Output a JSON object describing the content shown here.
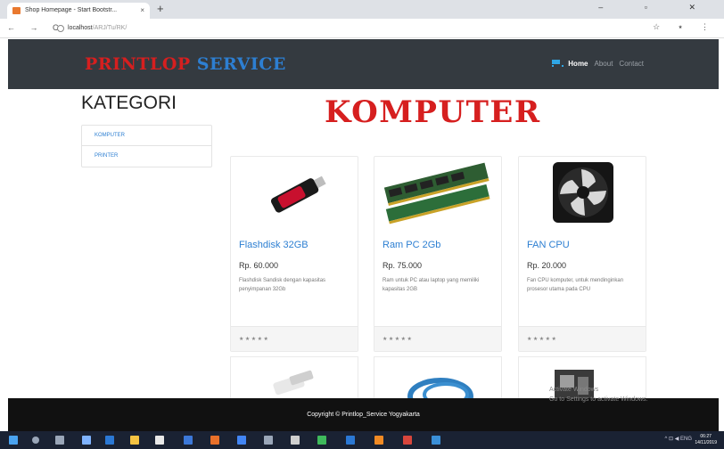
{
  "browser": {
    "tab_title": "Shop Homepage - Start Bootstr...",
    "tab_close": "×",
    "new_tab": "+",
    "window_controls": "– ▫ ✕",
    "nav_buttons": "← → C",
    "url_host": "localhost",
    "url_path": "/ARJ/Tu/RK/",
    "addr_right_icons": "☆ ⭑ ⋮"
  },
  "site": {
    "brand_part1": "PRINTLOP",
    "brand_part2": "SERVICE",
    "nav": [
      {
        "label": "Home"
      },
      {
        "label": "About"
      },
      {
        "label": "Contact"
      }
    ],
    "accent_red": "#d61f1f",
    "accent_blue": "#2d7fd2"
  },
  "sidebar": {
    "title": "KATEGORI",
    "items": [
      {
        "label": "KOMPUTER"
      },
      {
        "label": "PRINTER"
      }
    ]
  },
  "main": {
    "heading": "KOMPUTER",
    "products": [
      {
        "name": "Flashdisk 32GB",
        "price": "Rp. 60.000",
        "description": "Flashdisk Sandisk dengan kapasitas penyimpanan 32Gb",
        "rating": "★★★★★",
        "icon": "flashdisk-image"
      },
      {
        "name": "Ram PC 2Gb",
        "price": "Rp. 75.000",
        "description": "Ram untuk PC atau laptop yang memiliki kapasitas 2GB",
        "rating": "★★★★★",
        "icon": "ram-image"
      },
      {
        "name": "FAN CPU",
        "price": "Rp. 20.000",
        "description": "Fan CPU komputer, untuk mendinginkan prosesor utama pada CPU",
        "rating": "★★★★★",
        "icon": "fan-image"
      }
    ]
  },
  "footer": {
    "copyright": "Copyright © Printlop_Service Yogyakarta"
  },
  "windows": {
    "watermark_line1": "Activate Windows",
    "watermark_line2": "Go to Settings to activate Windows.",
    "clock_time": "06:27",
    "clock_date": "14/11/2019",
    "tray_text": "^ ⊡ ◀ ENG"
  }
}
